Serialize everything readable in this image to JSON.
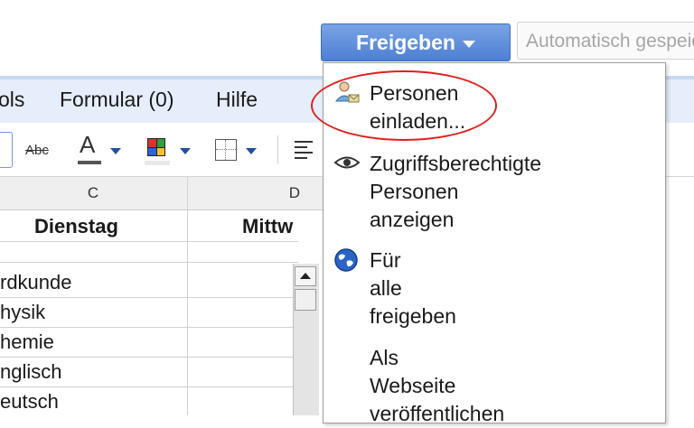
{
  "share_button": {
    "label": "Freigeben"
  },
  "autosave": {
    "text": "Automatisch gespeichert"
  },
  "menu": {
    "items": [
      "ols",
      "Formular (0)",
      "Hilfe"
    ]
  },
  "toolbar": {
    "strikethrough_label": "Abc",
    "font_color_label": "A"
  },
  "sheet": {
    "columns": [
      "C",
      "D"
    ],
    "header_cells": [
      "Dienstag",
      "Mittw"
    ],
    "rows": [
      "rdkunde",
      "hysik",
      "hemie",
      "nglisch",
      "eutsch"
    ]
  },
  "dropdown": {
    "items": [
      {
        "icon": "invite-people-icon",
        "lines": [
          "Personen",
          "einladen..."
        ]
      },
      {
        "icon": "eye-icon",
        "lines": [
          "Zugriffsberechtigte",
          "Personen",
          "anzeigen"
        ]
      },
      {
        "icon": "globe-icon",
        "lines": [
          "Für",
          "alle",
          "freigeben"
        ]
      },
      {
        "icon": null,
        "lines": [
          "Als",
          "Webseite",
          "veröffentlichen"
        ]
      }
    ]
  },
  "colors": {
    "accent_blue": "#4d7fd4",
    "annotation_red": "#e02020",
    "menubar_bg": "#e5eefa"
  }
}
